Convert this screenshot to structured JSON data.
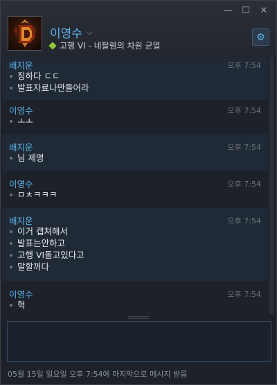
{
  "window": {
    "controls": {
      "minimize": "—",
      "maximize": "☐",
      "close": "✕"
    }
  },
  "header": {
    "contact_name": "이영수",
    "chevron": "⌵",
    "status_text": "고행 VI - 네팔렘의 차원 균열",
    "status_color": "#8fc93a",
    "name_color": "#5ab4ea"
  },
  "settings": {
    "icon": "gear-icon",
    "glyph": "⚙"
  },
  "messages": [
    {
      "sender": "배지운",
      "time": "오후 7:54",
      "lines": [
        "징하다 ㄷㄷ",
        "발표자료나만들어라"
      ],
      "shade": "dark"
    },
    {
      "sender": "이영수",
      "time": "오후 7:54",
      "lines": [
        "ㅗㅗ"
      ],
      "shade": "light"
    },
    {
      "sender": "배지운",
      "time": "오후 7:54",
      "lines": [
        "님 제명"
      ],
      "shade": "dark"
    },
    {
      "sender": "이영수",
      "time": "오후 7:54",
      "lines": [
        "ㅁㅊㅋㅋㅋ"
      ],
      "shade": "light"
    },
    {
      "sender": "배지운",
      "time": "오후 7:54",
      "lines": [
        "이거 캡쳐해서",
        "발표는안하고",
        "고행 VI돌고있다고",
        "말할꺼다"
      ],
      "shade": "dark"
    },
    {
      "sender": "이영수",
      "time": "오후 7:54",
      "lines": [
        "헉"
      ],
      "shade": "light"
    }
  ],
  "input": {
    "value": ""
  },
  "footer": {
    "last_message": "05월 15일 일요일 오후 7:54에 마지막으로 메시지 받음"
  }
}
